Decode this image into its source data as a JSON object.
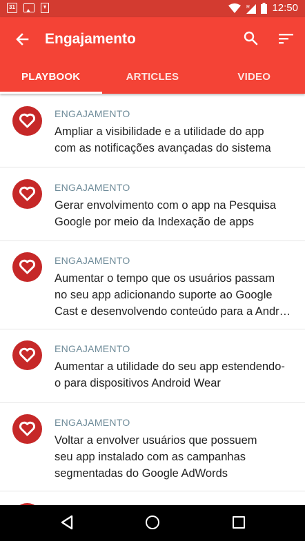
{
  "status_bar": {
    "calendar_day": "31",
    "time": "12:50",
    "icons": [
      "calendar-icon",
      "image-icon",
      "download-icon",
      "wifi-icon",
      "signal-icon",
      "battery-icon"
    ]
  },
  "app_bar": {
    "title": "Engajamento",
    "background_color": "#f44336",
    "status_color": "#d33b30"
  },
  "tabs": [
    {
      "label": "PLAYBOOK",
      "selected": true
    },
    {
      "label": "ARTICLES",
      "selected": false
    },
    {
      "label": "VIDEO",
      "selected": false
    }
  ],
  "list": {
    "items": [
      {
        "category": "ENGAJAMENTO",
        "lines": [
          "Ampliar a visibilidade e a utilidade do app",
          "com as notificações avançadas do sistema"
        ]
      },
      {
        "category": "ENGAJAMENTO",
        "lines": [
          "Gerar envolvimento com o app na Pesquisa",
          "Google por meio da Indexação de apps"
        ]
      },
      {
        "category": "ENGAJAMENTO",
        "lines": [
          "Aumentar o tempo que os usuários passam",
          "no seu app adicionando suporte ao Google",
          "Cast e desenvolvendo conteúdo para a Andr…"
        ]
      },
      {
        "category": "ENGAJAMENTO",
        "lines": [
          "Aumentar a utilidade do seu app estendendo-",
          "o para dispositivos Android Wear"
        ]
      },
      {
        "category": "ENGAJAMENTO",
        "lines": [
          "Voltar a envolver usuários que possuem",
          "seu app instalado com as campanhas",
          "segmentadas do Google AdWords"
        ]
      }
    ]
  },
  "nav_bar": {
    "buttons": [
      "back-nav-icon",
      "home-nav-icon",
      "recents-nav-icon"
    ]
  }
}
